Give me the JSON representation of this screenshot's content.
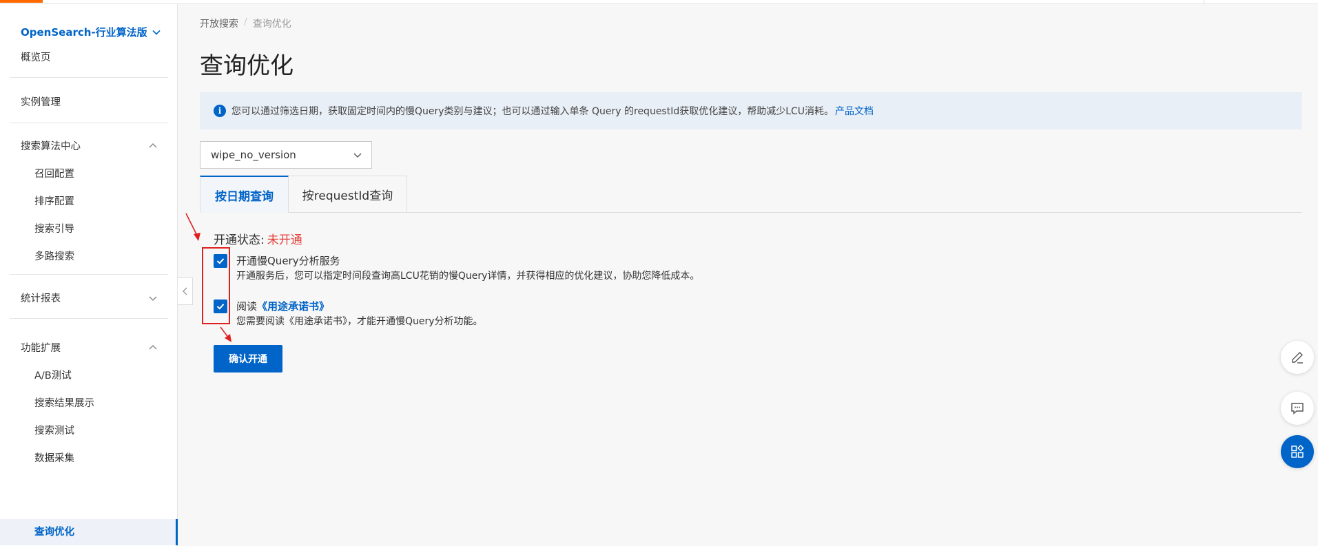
{
  "sidebar": {
    "product_title": "OpenSearch-行业算法版",
    "overview": "概览页",
    "instance_mgmt": "实例管理",
    "groups": {
      "algo_center": {
        "label": "搜索算法中心",
        "items": [
          "召回配置",
          "排序配置",
          "搜索引导",
          "多路搜索"
        ]
      },
      "stats": {
        "label": "统计报表"
      },
      "extensions": {
        "label": "功能扩展",
        "items": [
          "A/B测试",
          "搜索结果展示",
          "搜索测试",
          "数据采集",
          "查询优化"
        ]
      }
    }
  },
  "breadcrumb": {
    "root": "开放搜索",
    "sep": "/",
    "current": "查询优化"
  },
  "page_title": "查询优化",
  "notice": {
    "text": "您可以通过筛选日期，获取固定时间内的慢Query类别与建议；也可以通过输入单条 Query 的requestId获取优化建议，帮助减少LCU消耗。",
    "link": "产品文档"
  },
  "select": {
    "value": "wipe_no_version"
  },
  "tabs": {
    "by_date": "按日期查询",
    "by_request": "按requestId查询"
  },
  "status": {
    "label": "开通状态:",
    "value": "未开通"
  },
  "checks": {
    "service": {
      "title": "开通慢Query分析服务",
      "desc": "开通服务后，您可以指定时间段查询高LCU花销的慢Query详情，并获得相应的优化建议，协助您降低成本。"
    },
    "agreement": {
      "prefix": "阅读",
      "link": "《用途承诺书》",
      "desc": "您需要阅读《用途承诺书》，才能开通慢Query分析功能。"
    }
  },
  "confirm_button": "确认开通",
  "colors": {
    "accent": "#0064c8",
    "brand_orange": "#ff6a00",
    "status_red": "#e5413b",
    "annotation_red": "#e02020"
  }
}
